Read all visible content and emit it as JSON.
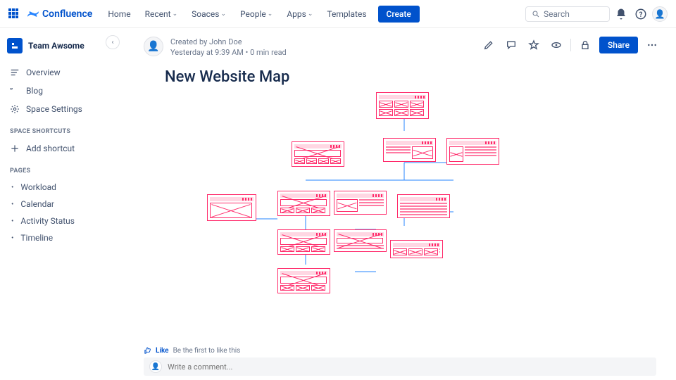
{
  "topnav": {
    "brand": "Confluence",
    "links": [
      "Home",
      "Recent",
      "Soaces",
      "People",
      "Apps",
      "Templates"
    ],
    "create": "Create",
    "search_placeholder": "Search"
  },
  "sidebar": {
    "space_name": "Team Awsome",
    "nav": {
      "overview": "Overview",
      "blog": "Blog",
      "settings": "Space Settings"
    },
    "shortcuts_head": "SPACE SHORTCUTS",
    "add_shortcut": "Add shortcut",
    "pages_head": "PAGES",
    "pages": [
      "Workload",
      "Calendar",
      "Activity Status",
      "Timeline"
    ]
  },
  "page": {
    "created_by": "Created by John Doe",
    "timestamp": "Yesterday at 9:39 AM",
    "read_time": "0 min read",
    "title": "New Website Map",
    "share": "Share",
    "like_label": "Like",
    "like_status": "Be the first to like this",
    "comment_placeholder": "Write a comment..."
  }
}
